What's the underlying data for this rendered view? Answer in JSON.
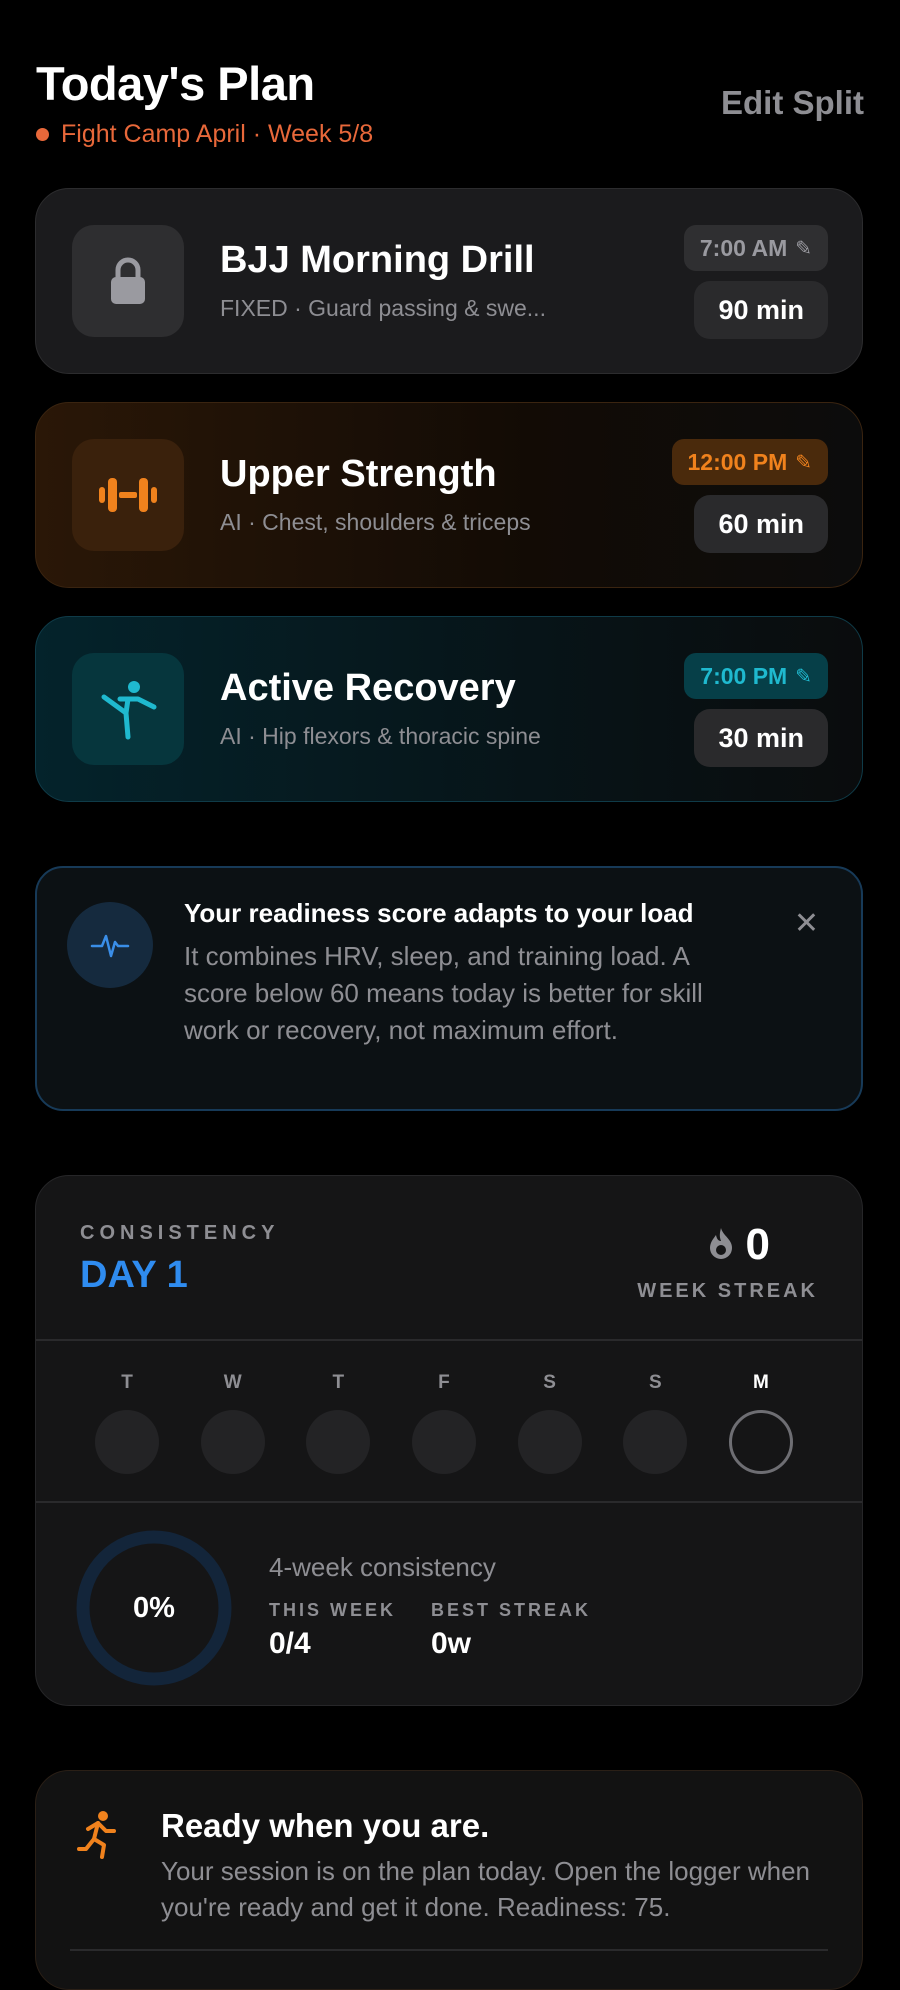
{
  "header": {
    "title": "Today's Plan",
    "subtitle": "Fight Camp April · Week 5/8",
    "edit_label": "Edit Split"
  },
  "sessions": [
    {
      "name": "BJJ Morning Drill",
      "desc": "FIXED · Guard passing & swe...",
      "time": "7:00 AM",
      "duration": "90 min",
      "icon": "lock-icon",
      "accent": "#9a9aa0"
    },
    {
      "name": "Upper Strength",
      "desc": "AI · Chest, shoulders & triceps",
      "time": "12:00 PM",
      "duration": "60 min",
      "icon": "dumbbell-icon",
      "accent": "#f0821d"
    },
    {
      "name": "Active Recovery",
      "desc": "AI · Hip flexors & thoracic spine",
      "time": "7:00 PM",
      "duration": "30 min",
      "icon": "stretch-figure-icon",
      "accent": "#1fb9cf"
    }
  ],
  "info": {
    "title": "Your readiness score adapts to your load",
    "body": "It combines HRV, sleep, and training load. A score below 60 means today is better for skill work or recovery, not maximum effort.",
    "icon": "heartbeat-icon"
  },
  "consistency": {
    "label": "CONSISTENCY",
    "day": "DAY 1",
    "streak_value": "0",
    "streak_label": "WEEK STREAK",
    "days": [
      {
        "letter": "T",
        "today": false
      },
      {
        "letter": "W",
        "today": false
      },
      {
        "letter": "T",
        "today": false
      },
      {
        "letter": "F",
        "today": false
      },
      {
        "letter": "S",
        "today": false
      },
      {
        "letter": "S",
        "today": false
      },
      {
        "letter": "M",
        "today": true
      }
    ],
    "ring_percent": "0%",
    "ring_fraction": 0,
    "four_week_label": "4-week consistency",
    "this_week_label": "THIS WEEK",
    "this_week_value": "0/4",
    "best_streak_label": "BEST STREAK",
    "best_streak_value": "0w"
  },
  "ready": {
    "title": "Ready when you are.",
    "body": "Your session is on the plan today. Open the logger when you're ready and get it done. Readiness: 75.",
    "icon": "runner-icon"
  },
  "colors": {
    "accent_orange": "#e8683a",
    "accent_blue": "#2f8cf0",
    "muted": "#8e8e93"
  }
}
